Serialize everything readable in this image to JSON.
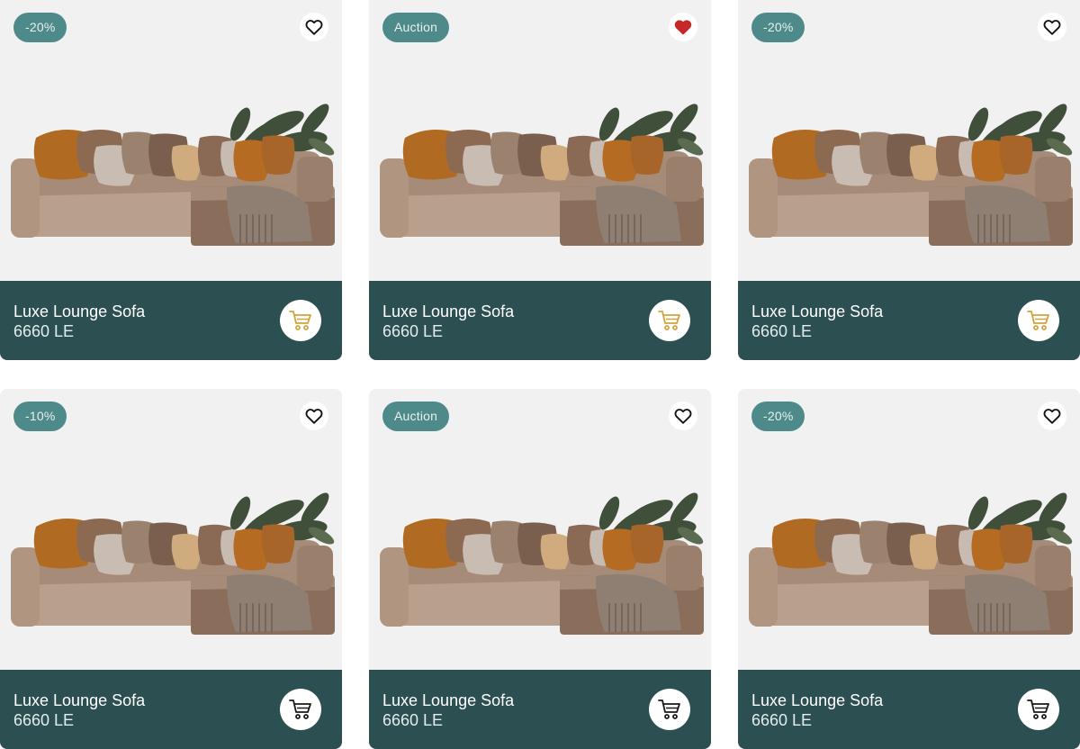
{
  "colors": {
    "badge_bg": "#4f8a8b",
    "footer_bg": "#2c4f52",
    "card_bg": "#f1f1f1",
    "heart_active": "#c62828",
    "cart_gold": "#d4a23c",
    "cart_dark": "#1a1a1a"
  },
  "products": [
    {
      "badge": "-20%",
      "name": "Luxe Lounge Sofa",
      "price": "6660 LE",
      "favorite": false,
      "cart_style": "gold",
      "image": "sofa-image"
    },
    {
      "badge": "Auction",
      "name": "Luxe Lounge Sofa",
      "price": "6660 LE",
      "favorite": true,
      "cart_style": "gold",
      "image": "sofa-image"
    },
    {
      "badge": "-20%",
      "name": "Luxe Lounge Sofa",
      "price": "6660 LE",
      "favorite": false,
      "cart_style": "gold",
      "image": "sofa-image"
    },
    {
      "badge": "-10%",
      "name": "Luxe Lounge Sofa",
      "price": "6660 LE",
      "favorite": false,
      "cart_style": "dark",
      "image": "sofa-image"
    },
    {
      "badge": "Auction",
      "name": "Luxe Lounge Sofa",
      "price": "6660 LE",
      "favorite": false,
      "cart_style": "dark",
      "image": "sofa-image"
    },
    {
      "badge": "-20%",
      "name": "Luxe Lounge Sofa",
      "price": "6660 LE",
      "favorite": false,
      "cart_style": "dark",
      "image": "sofa-image"
    }
  ]
}
